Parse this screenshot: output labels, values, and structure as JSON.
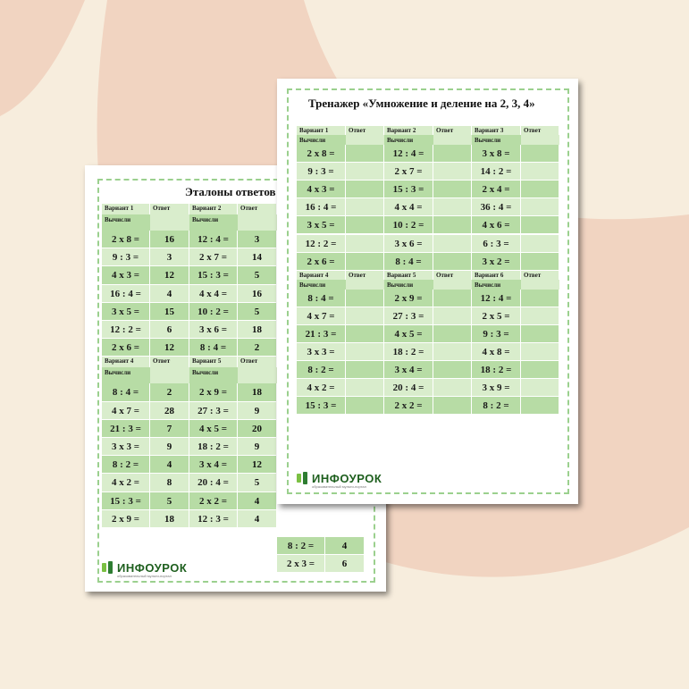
{
  "colors": {
    "background": "#f7eddd",
    "blob": "#f1d4c1",
    "row_dark": "#b7dca5",
    "row_light": "#d9edcc",
    "frame": "#9bd08e"
  },
  "logo": {
    "name": "ИНФОУРОК",
    "tagline": "образовательный мульти-портал",
    "icon": "infourok-logo-icon"
  },
  "back_sheet": {
    "title": "Эталоны ответов",
    "groups": [
      {
        "headers": [
          "Вариант 1",
          "Ответ",
          "Вариант 2",
          "Ответ"
        ],
        "subheaders": [
          "Вычисли",
          "Вычисли"
        ],
        "rows": [
          [
            "2 x 8 =",
            "16",
            "12 : 4 =",
            "3"
          ],
          [
            "9 : 3 =",
            "3",
            "2 x 7 =",
            "14"
          ],
          [
            "4 x 3 =",
            "12",
            "15 : 3 =",
            "5"
          ],
          [
            "16 : 4 =",
            "4",
            "4 x 4 =",
            "16"
          ],
          [
            "3 x 5 =",
            "15",
            "10 : 2 =",
            "5"
          ],
          [
            "12 : 2 =",
            "6",
            "3 x 6 =",
            "18"
          ],
          [
            "2 x 6 =",
            "12",
            "8 : 4 =",
            "2"
          ]
        ]
      },
      {
        "headers": [
          "Вариант 4",
          "Ответ",
          "Вариант 5",
          "Ответ"
        ],
        "subheaders": [
          "Вычисли",
          "Вычисли"
        ],
        "rows": [
          [
            "8 : 4 =",
            "2",
            "2 x 9 =",
            "18"
          ],
          [
            "4 x 7 =",
            "28",
            "27 : 3 =",
            "9"
          ],
          [
            "21 : 3 =",
            "7",
            "4 x 5 =",
            "20"
          ],
          [
            "3 x 3 =",
            "9",
            "18 : 2 =",
            "9"
          ],
          [
            "8 : 2 =",
            "4",
            "3 x 4 =",
            "12"
          ],
          [
            "4 x 2 =",
            "8",
            "20 : 4 =",
            "5"
          ],
          [
            "15 : 3 =",
            "5",
            "2 x 2 =",
            "4"
          ],
          [
            "2 x 9 =",
            "18",
            "12 : 3 =",
            "4"
          ]
        ]
      }
    ],
    "extra": {
      "peek_expr": "8 : 2 =",
      "peek_ans": "4",
      "last_expr": "2 x 3 =",
      "last_ans": "6"
    }
  },
  "front_sheet": {
    "title": "Тренажер «Умножение и деление на 2, 3, 4»",
    "groups": [
      {
        "headers": [
          "Вариант 1",
          "Ответ",
          "Вариант 2",
          "Ответ",
          "Вариант 3",
          "Ответ"
        ],
        "subheaders": [
          "Вычисли",
          "Вычисли",
          "Вычисли"
        ],
        "rows": [
          [
            "2 x 8 =",
            "",
            "12 : 4 =",
            "",
            "3 x 8 =",
            ""
          ],
          [
            "9 : 3 =",
            "",
            "2 x 7 =",
            "",
            "14 : 2 =",
            ""
          ],
          [
            "4 x 3 =",
            "",
            "15 : 3 =",
            "",
            "2 x 4 =",
            ""
          ],
          [
            "16 : 4 =",
            "",
            "4 x 4 =",
            "",
            "36 : 4 =",
            ""
          ],
          [
            "3 x 5 =",
            "",
            "10 : 2 =",
            "",
            "4 x 6 =",
            ""
          ],
          [
            "12 : 2 =",
            "",
            "3 x 6 =",
            "",
            "6 : 3 =",
            ""
          ],
          [
            "2 x 6 =",
            "",
            "8 : 4 =",
            "",
            "3 x 2 =",
            ""
          ]
        ]
      },
      {
        "headers": [
          "Вариант 4",
          "Ответ",
          "Вариант 5",
          "Ответ",
          "Вариант 6",
          "Ответ"
        ],
        "subheaders": [
          "Вычисли",
          "Вычисли",
          "Вычисли"
        ],
        "rows": [
          [
            "8 : 4 =",
            "",
            "2 x 9 =",
            "",
            "12 : 4 =",
            ""
          ],
          [
            "4 x 7 =",
            "",
            "27 : 3 =",
            "",
            "2 x 5 =",
            ""
          ],
          [
            "21 : 3 =",
            "",
            "4 x 5 =",
            "",
            "9 : 3 =",
            ""
          ],
          [
            "3 x 3 =",
            "",
            "18 : 2 =",
            "",
            "4 x 8 =",
            ""
          ],
          [
            "8 : 2 =",
            "",
            "3 x 4 =",
            "",
            "18 : 2 =",
            ""
          ],
          [
            "4 x 2 =",
            "",
            "20 : 4 =",
            "",
            "3 x 9 =",
            ""
          ],
          [
            "15 : 3 =",
            "",
            "2 x 2 =",
            "",
            "8 : 2 =",
            ""
          ]
        ]
      }
    ]
  }
}
